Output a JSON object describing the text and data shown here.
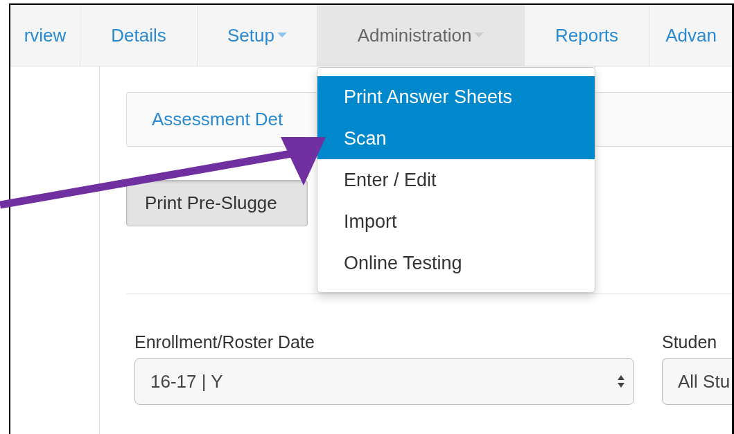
{
  "tabs": [
    {
      "label": "rview",
      "selected": false,
      "caret": false
    },
    {
      "label": "Details",
      "selected": false,
      "caret": false
    },
    {
      "label": "Setup",
      "selected": false,
      "caret": true
    },
    {
      "label": "Administration",
      "selected": true,
      "caret": true
    },
    {
      "label": "Reports",
      "selected": false,
      "caret": false
    },
    {
      "label": "Advan",
      "selected": false,
      "caret": false
    }
  ],
  "dropdown": {
    "items": [
      {
        "label": "Print Answer Sheets",
        "selected": true
      },
      {
        "label": "Scan",
        "selected": true
      },
      {
        "label": "Enter / Edit",
        "selected": false
      },
      {
        "label": "Import",
        "selected": false
      },
      {
        "label": "Online Testing",
        "selected": false
      }
    ]
  },
  "panel": {
    "title": "Assessment Det"
  },
  "print_button": {
    "label": "Print Pre-Slugge"
  },
  "fields": [
    {
      "label": "Enrollment/Roster Date",
      "value": "16-17 | Y"
    },
    {
      "label": "Studen",
      "value": "All Stu"
    }
  ]
}
